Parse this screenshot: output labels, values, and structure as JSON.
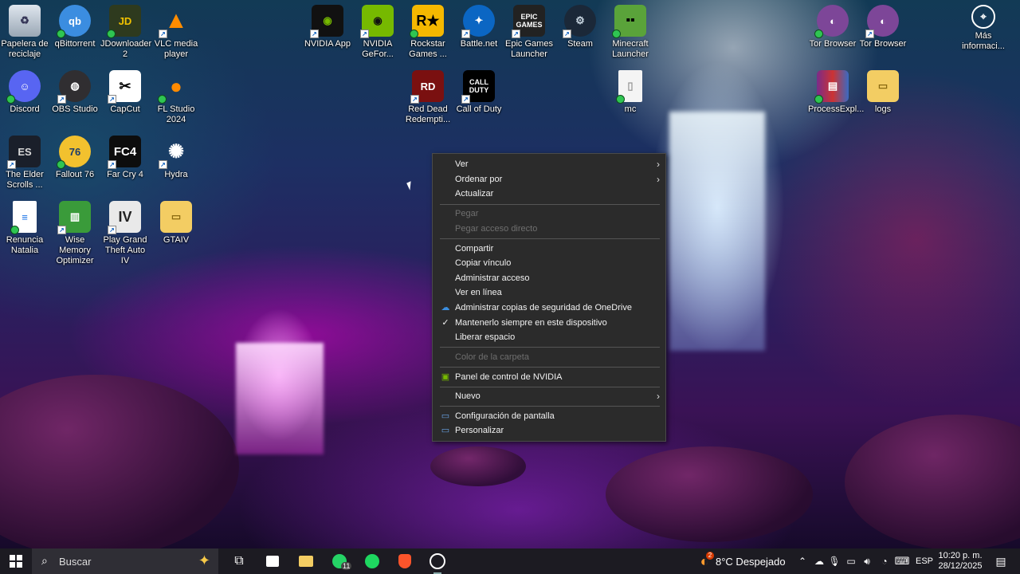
{
  "desktop_icons": [
    {
      "label": "Papelera de reciclaje",
      "icon": "recycle-bin-icon"
    },
    {
      "label": "qBittorrent",
      "icon": "qbittorrent-icon"
    },
    {
      "label": "JDownloader 2",
      "icon": "jdownloader-icon"
    },
    {
      "label": "VLC media player",
      "icon": "vlc-icon"
    },
    {
      "label": "NVIDIA App",
      "icon": "nvidia-icon"
    },
    {
      "label": "NVIDIA GeFor...",
      "icon": "nvidia-geforce-icon"
    },
    {
      "label": "Rockstar Games ...",
      "icon": "rockstar-icon"
    },
    {
      "label": "Battle.net",
      "icon": "battlenet-icon"
    },
    {
      "label": "Epic Games Launcher",
      "icon": "epic-games-icon"
    },
    {
      "label": "Steam",
      "icon": "steam-icon"
    },
    {
      "label": "Minecraft Launcher",
      "icon": "minecraft-icon"
    },
    {
      "label": "Tor Browser",
      "icon": "tor-browser-icon"
    },
    {
      "label": "Tor Browser",
      "icon": "tor-browser-icon"
    },
    {
      "label": "Más informaci...",
      "icon": "info-icon"
    },
    {
      "label": "Discord",
      "icon": "discord-icon"
    },
    {
      "label": "OBS Studio",
      "icon": "obs-icon"
    },
    {
      "label": "CapCut",
      "icon": "capcut-icon"
    },
    {
      "label": "FL Studio 2024",
      "icon": "fl-studio-icon"
    },
    {
      "label": "Red Dead Redempti...",
      "icon": "rdr-icon"
    },
    {
      "label": "Call of Duty",
      "icon": "cod-icon"
    },
    {
      "label": "mc",
      "icon": "file-icon"
    },
    {
      "label": "ProcessExpl...",
      "icon": "winrar-icon"
    },
    {
      "label": "logs",
      "icon": "folder-icon"
    },
    {
      "label": "The Elder Scrolls ...",
      "icon": "elder-scrolls-icon"
    },
    {
      "label": "Fallout 76",
      "icon": "fallout-icon"
    },
    {
      "label": "Far Cry 4",
      "icon": "farcry-icon"
    },
    {
      "label": "Hydra",
      "icon": "hydra-icon"
    },
    {
      "label": "Renuncia Natalia",
      "icon": "document-icon"
    },
    {
      "label": "Wise Memory Optimizer",
      "icon": "wise-memory-icon"
    },
    {
      "label": "Play Grand Theft Auto IV",
      "icon": "gta-iv-icon"
    },
    {
      "label": "GTAIV",
      "icon": "folder-icon"
    }
  ],
  "menu": {
    "ver": "Ver",
    "ordenar": "Ordenar por",
    "actualizar": "Actualizar",
    "pegar": "Pegar",
    "pegar_acceso": "Pegar acceso directo",
    "compartir": "Compartir",
    "copiar_vinculo": "Copiar vínculo",
    "administrar_acceso": "Administrar acceso",
    "ver_en_linea": "Ver en línea",
    "onedrive_backup": "Administrar copias de seguridad de OneDrive",
    "mantener": "Mantenerlo siempre en este dispositivo",
    "liberar": "Liberar espacio",
    "color_carpeta": "Color de la carpeta",
    "nvidia_panel": "Panel de control de NVIDIA",
    "nuevo": "Nuevo",
    "config_pantalla": "Configuración de pantalla",
    "personalizar": "Personalizar"
  },
  "taskbar": {
    "search_placeholder": "Buscar",
    "weather_badge": "2",
    "weather": "8°C Despejado",
    "language": "ESP",
    "time": "10:20 p. m.",
    "date": "28/12/2025",
    "whatsapp_badge": "11"
  }
}
